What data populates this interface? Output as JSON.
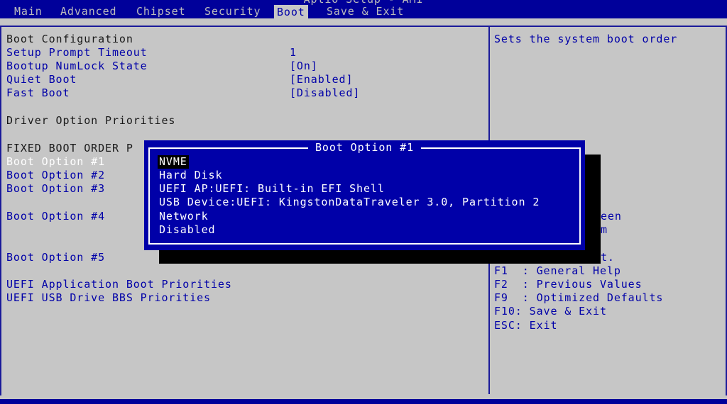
{
  "app": {
    "title": "Aptio Setup - AMI"
  },
  "tabs": [
    {
      "label": "Main"
    },
    {
      "label": "Advanced"
    },
    {
      "label": "Chipset"
    },
    {
      "label": "Security"
    },
    {
      "label": "Boot",
      "active": true
    },
    {
      "label": "Save & Exit"
    }
  ],
  "left": {
    "boot_configuration": "Boot Configuration",
    "setup_prompt_timeout": {
      "label": "Setup Prompt Timeout",
      "value": "1"
    },
    "numlock": {
      "label": "Bootup NumLock State",
      "value": "[On]"
    },
    "quiet_boot": {
      "label": "Quiet Boot",
      "value": "[Enabled]"
    },
    "fast_boot": {
      "label": "Fast Boot",
      "value": "[Disabled]"
    },
    "driver_option_priorities": "Driver Option Priorities",
    "fixed_boot_order": "FIXED BOOT ORDER P",
    "boot_option_1": "Boot Option #1",
    "boot_option_2": "Boot Option #2",
    "boot_option_3": "Boot Option #3",
    "boot_option_4": "Boot Option #4",
    "boot_option_5": "Boot Option #5",
    "uefi_app_priorities": "UEFI Application Boot Priorities",
    "uefi_usb_priorities": "UEFI USB Drive BBS Priorities"
  },
  "help": {
    "description": "Sets the system boot order",
    "partial": [
      "een",
      "m",
      "t."
    ],
    "keys": [
      "F1  : General Help",
      "F2  : Previous Values",
      "F9  : Optimized Defaults",
      "F10: Save & Exit",
      "ESC: Exit"
    ]
  },
  "popup": {
    "title": "Boot Option #1",
    "items": [
      {
        "label": "NVME",
        "selected": true
      },
      {
        "label": "Hard Disk"
      },
      {
        "label": "UEFI AP:UEFI: Built-in EFI Shell"
      },
      {
        "label": "USB Device:UEFI: KingstonDataTraveler 3.0, Partition 2"
      },
      {
        "label": "Network"
      },
      {
        "label": "Disabled"
      }
    ]
  },
  "colors": {
    "background": "#c6c6c6",
    "bar": "#00009a",
    "text_blue": "#0000a8",
    "popup": "#0000a8"
  }
}
